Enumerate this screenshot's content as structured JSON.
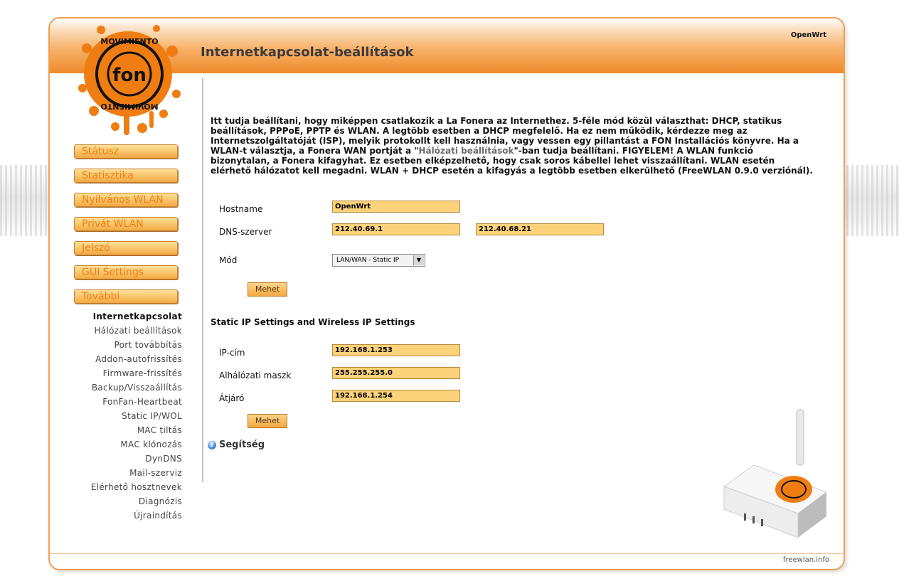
{
  "brand": "OpenWrt",
  "page_title": "Internetkapcsolat-beállítások",
  "logo": {
    "top_text": "MOVIMIENTO",
    "center_text": "fon",
    "bottom_text": "MOVIMIENTO"
  },
  "nav": {
    "main": [
      "Státusz",
      "Statisztika",
      "Nyilvános WLAN",
      "Privát WLAN",
      "Jelszó",
      "GUI Settings",
      "További"
    ],
    "sub": [
      "Internetkapcsolat",
      "Hálózati beállítások",
      "Port továbbítás",
      "Addon-autofrissítés",
      "Firmware-frissítés",
      "Backup/Visszaállítás",
      "FonFan-Heartbeat",
      "Static IP/WOL",
      "MAC tiltás",
      "MAC klónozás",
      "DynDNS",
      "Mail-szerviz",
      "Elérhető hosztnevek",
      "Diagnózis",
      "Újraindítás"
    ],
    "active_sub": "Internetkapcsolat"
  },
  "intro": {
    "part1": "Itt tudja beállítani, hogy miképpen csatlakozik a La Fonera az Internethez. 5-féle mód közül választhat: DHCP, statikus beállítások, PPPoE, PPTP és WLAN. A legtöbb esetben a DHCP megfelelő. Ha ez nem működik, kérdezze meg az Internetszolgáltatóját (ISP), melyik protokollt kell használnia, vagy vessen egy pillantást a FON Installációs könyvre. Ha a WLAN-t választja, a Fonera WAN portját a \"",
    "link": "Hálózati beállítások",
    "part2": "\"-ban tudja beállítani. FIGYELEM! A WLAN funkció bizonytalan, a Fonera kifagyhat. Ez esetben elképzelhető, hogy csak soros kábellel lehet visszaállítani. WLAN esetén elérhető hálózatot kell megadni. WLAN + DHCP esetén a kifagyás a legtöbb esetben elkerülhető (FreeWLAN 0.9.0 verziónál)."
  },
  "form": {
    "hostname": {
      "label": "Hostname",
      "value": "OpenWrt"
    },
    "dns": {
      "label": "DNS-szerver",
      "primary": "212.40.69.1",
      "secondary": "212.40.68.21"
    },
    "mode": {
      "label": "Mód",
      "selected": "LAN/WAN - Static IP"
    },
    "submit1": "Mehet"
  },
  "static_section": {
    "heading": "Static IP Settings and Wireless IP Settings",
    "ip": {
      "label": "IP-cím",
      "value": "192.168.1.253"
    },
    "netmask": {
      "label": "Alhálózati maszk",
      "value": "255.255.255.0"
    },
    "gateway": {
      "label": "Átjáró",
      "value": "192.168.1.254"
    },
    "submit2": "Mehet"
  },
  "help": {
    "label": "Segítség",
    "icon": "help-icon"
  },
  "footer": "freewlan.info",
  "colors": {
    "accent": "#ef8a2a",
    "field_bg": "#fcd27a",
    "nav_text": "#f07d10",
    "border": "#f0a04f"
  }
}
